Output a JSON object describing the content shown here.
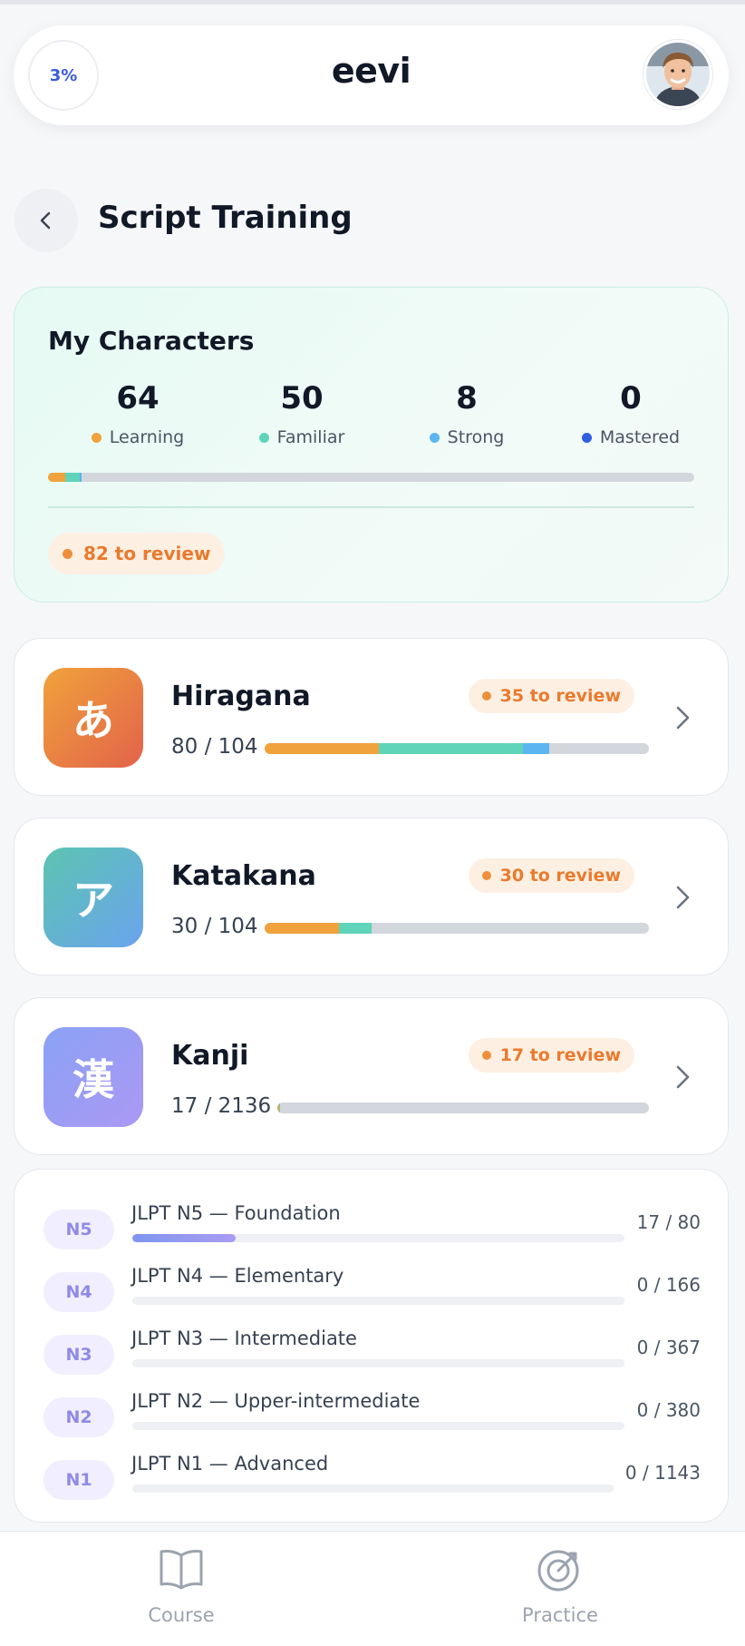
{
  "header": {
    "progress": "3%",
    "brand": "eevi"
  },
  "page": {
    "title": "Script Training"
  },
  "my_characters": {
    "title": "My Characters",
    "stats": [
      {
        "value": "64",
        "label": "Learning",
        "color": "#f0a23c"
      },
      {
        "value": "50",
        "label": "Familiar",
        "color": "#5fd4b8"
      },
      {
        "value": "8",
        "label": "Strong",
        "color": "#5bb5f0"
      },
      {
        "value": "0",
        "label": "Mastered",
        "color": "#2f5fe0"
      }
    ],
    "review": "82 to review"
  },
  "scripts": [
    {
      "glyph": "あ",
      "name": "Hiragana",
      "count": "80 / 104",
      "review": "35 to review",
      "learning": 31,
      "familiar": 39,
      "strong": 7,
      "total": 104
    },
    {
      "glyph": "ア",
      "name": "Katakana",
      "count": "30 / 104",
      "review": "30 to review",
      "learning": 20,
      "familiar": 9,
      "strong": 0,
      "total": 104
    },
    {
      "glyph": "漢",
      "name": "Kanji",
      "count": "17 / 2136",
      "review": "17 to review",
      "learning": 13,
      "familiar": 4,
      "strong": 0,
      "total": 2136
    }
  ],
  "jlpt": [
    {
      "level": "N5",
      "title": "JLPT N5 — Foundation",
      "count": "17 / 80",
      "progress": 0.21
    },
    {
      "level": "N4",
      "title": "JLPT N4 — Elementary",
      "count": "0 / 166",
      "progress": 0
    },
    {
      "level": "N3",
      "title": "JLPT N3 — Intermediate",
      "count": "0 / 367",
      "progress": 0
    },
    {
      "level": "N2",
      "title": "JLPT N2 — Upper-intermediate",
      "count": "0 / 380",
      "progress": 0
    },
    {
      "level": "N1",
      "title": "JLPT N1 — Advanced",
      "count": "0 / 1143",
      "progress": 0
    }
  ],
  "nav": {
    "course": "Course",
    "practice": "Practice"
  },
  "icons": {
    "back": "chevron-left-icon",
    "chevron": "chevron-right-icon",
    "course": "book-icon",
    "practice": "target-icon"
  },
  "colors": {
    "learning": "#f0a23c",
    "familiar": "#5fd4b8",
    "strong": "#5bb5f0",
    "mastered": "#2f5fe0",
    "review": "#ea7a2d"
  }
}
